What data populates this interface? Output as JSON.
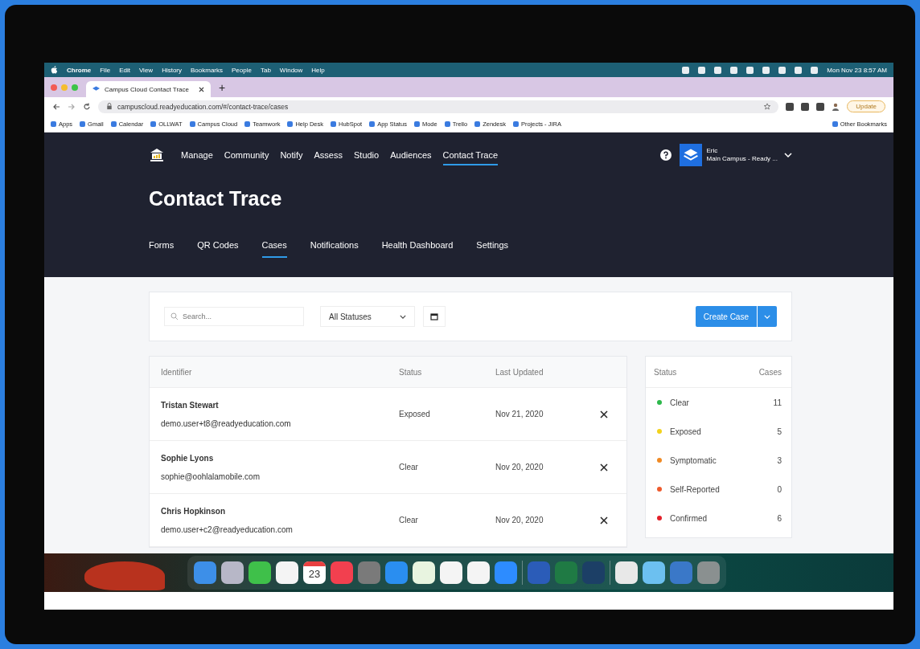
{
  "menu_bar": {
    "items": [
      "Chrome",
      "File",
      "Edit",
      "View",
      "History",
      "Bookmarks",
      "People",
      "Tab",
      "Window",
      "Help"
    ],
    "clock": "Mon Nov 23  8:57 AM"
  },
  "browser": {
    "tab_title": "Campus Cloud Contact Trace",
    "new_tab": "+",
    "url": "campuscloud.readyeducation.com/#/contact-trace/cases",
    "update_button": "Update",
    "bookmarks": [
      "Apps",
      "Gmail",
      "Calendar",
      "OLLWAT",
      "Campus Cloud",
      "Teamwork",
      "Help Desk",
      "HubSpot",
      "App Status",
      "Mode",
      "Trello",
      "Zendesk",
      "Projects - JIRA"
    ],
    "other_bookmarks": "Other Bookmarks"
  },
  "app_nav": {
    "items": [
      {
        "label": "Manage",
        "selected": false
      },
      {
        "label": "Community",
        "selected": false
      },
      {
        "label": "Notify",
        "selected": false
      },
      {
        "label": "Assess",
        "selected": false
      },
      {
        "label": "Studio",
        "selected": false
      },
      {
        "label": "Audiences",
        "selected": false
      },
      {
        "label": "Contact Trace",
        "selected": true
      }
    ],
    "user": {
      "name": "Eric",
      "org": "Main Campus - Ready ..."
    }
  },
  "page_title": "Contact Trace",
  "sub_tabs": [
    {
      "label": "Forms",
      "selected": false
    },
    {
      "label": "QR Codes",
      "selected": false
    },
    {
      "label": "Cases",
      "selected": true
    },
    {
      "label": "Notifications",
      "selected": false
    },
    {
      "label": "Health Dashboard",
      "selected": false
    },
    {
      "label": "Settings",
      "selected": false
    }
  ],
  "toolbar": {
    "search": {
      "placeholder": "Search..."
    },
    "status_filter": "All Statuses",
    "create_button": "Create Case"
  },
  "table": {
    "columns": [
      "Identifier",
      "Status",
      "Last Updated"
    ],
    "rows": [
      {
        "name": "Tristan Stewart",
        "email": "demo.user+t8@readyeducation.com",
        "status": "Exposed",
        "last_updated": "Nov 21, 2020"
      },
      {
        "name": "Sophie Lyons",
        "email": "sophie@oohlalamobile.com",
        "status": "Clear",
        "last_updated": "Nov 20, 2020"
      },
      {
        "name": "Chris Hopkinson",
        "email": "demo.user+c2@readyeducation.com",
        "status": "Clear",
        "last_updated": "Nov 20, 2020"
      }
    ]
  },
  "summary": {
    "columns": [
      "Status",
      "Cases"
    ],
    "rows": [
      {
        "status": "Clear",
        "cases": "11",
        "color": "#2db84b"
      },
      {
        "status": "Exposed",
        "cases": "5",
        "color": "#f2d21c"
      },
      {
        "status": "Symptomatic",
        "cases": "3",
        "color": "#f08a24"
      },
      {
        "status": "Self-Reported",
        "cases": "0",
        "color": "#ee5a2c"
      },
      {
        "status": "Confirmed",
        "cases": "6",
        "color": "#e3202a"
      }
    ]
  },
  "dock": {
    "calendar_day": "23"
  }
}
